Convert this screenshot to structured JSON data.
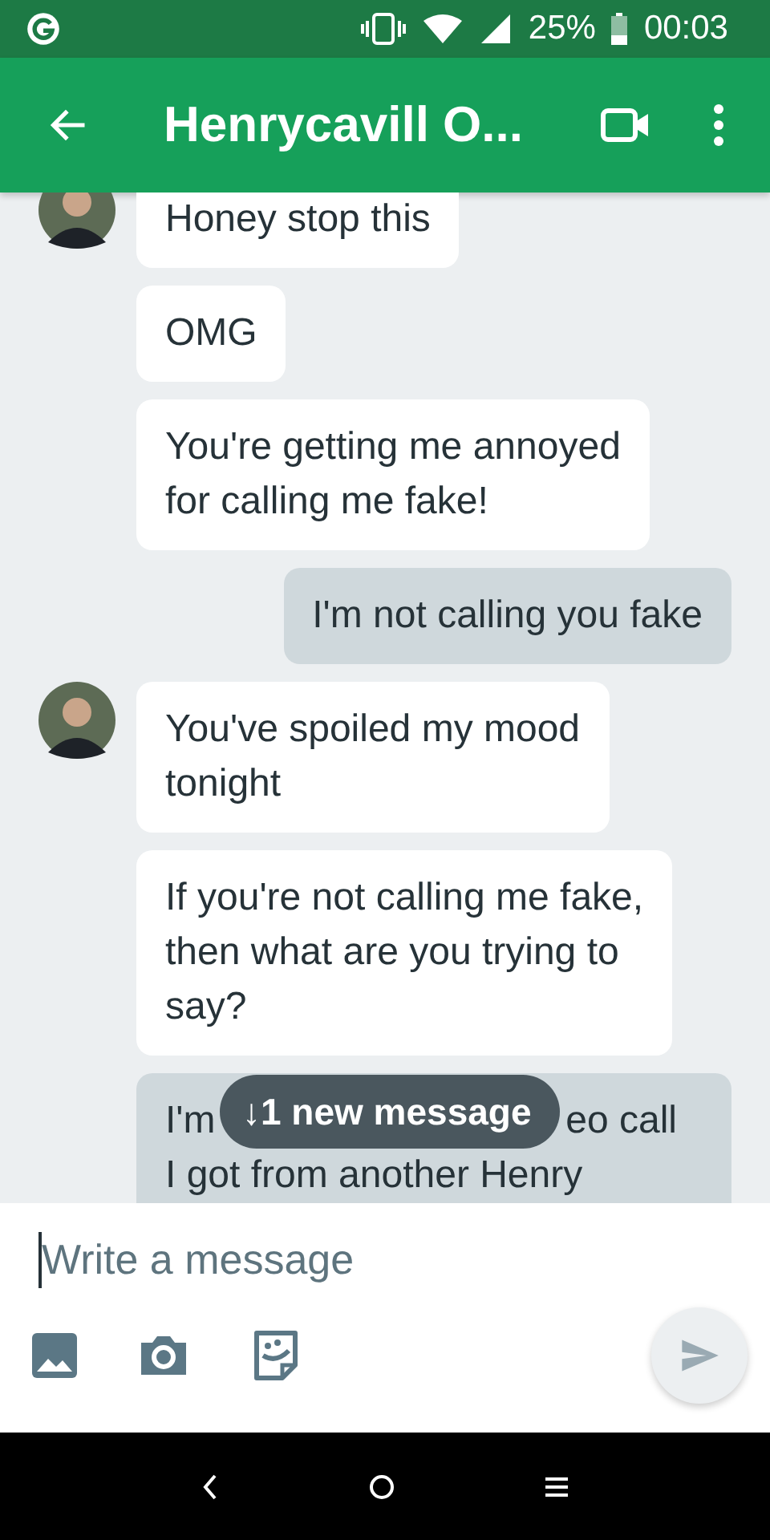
{
  "status_bar": {
    "battery": "25%",
    "time": "00:03"
  },
  "header": {
    "title": "Henrycavill O..."
  },
  "messages": [
    {
      "outgoing": false,
      "avatar": true,
      "lines": [
        "Honey stop this"
      ]
    },
    {
      "outgoing": false,
      "avatar": false,
      "lines": [
        "OMG"
      ]
    },
    {
      "outgoing": false,
      "avatar": false,
      "lines": [
        "You're getting me annoyed",
        "for calling me fake!"
      ]
    },
    {
      "outgoing": true,
      "avatar": false,
      "lines": [
        "I'm not calling you fake"
      ]
    },
    {
      "outgoing": false,
      "avatar": true,
      "lines": [
        "You've spoiled my mood",
        "tonight"
      ]
    },
    {
      "outgoing": false,
      "avatar": false,
      "lines": [
        "If you're not calling me fake,",
        "then what are you trying to",
        "say?"
      ]
    },
    {
      "outgoing": true,
      "avatar": false,
      "covered": true,
      "lines": [
        "I'm",
        "eo call",
        "I got from another Henry"
      ]
    }
  ],
  "new_message_pill": {
    "arrow": "↓",
    "label": "1 new message"
  },
  "composer": {
    "placeholder": "Write a message"
  }
}
